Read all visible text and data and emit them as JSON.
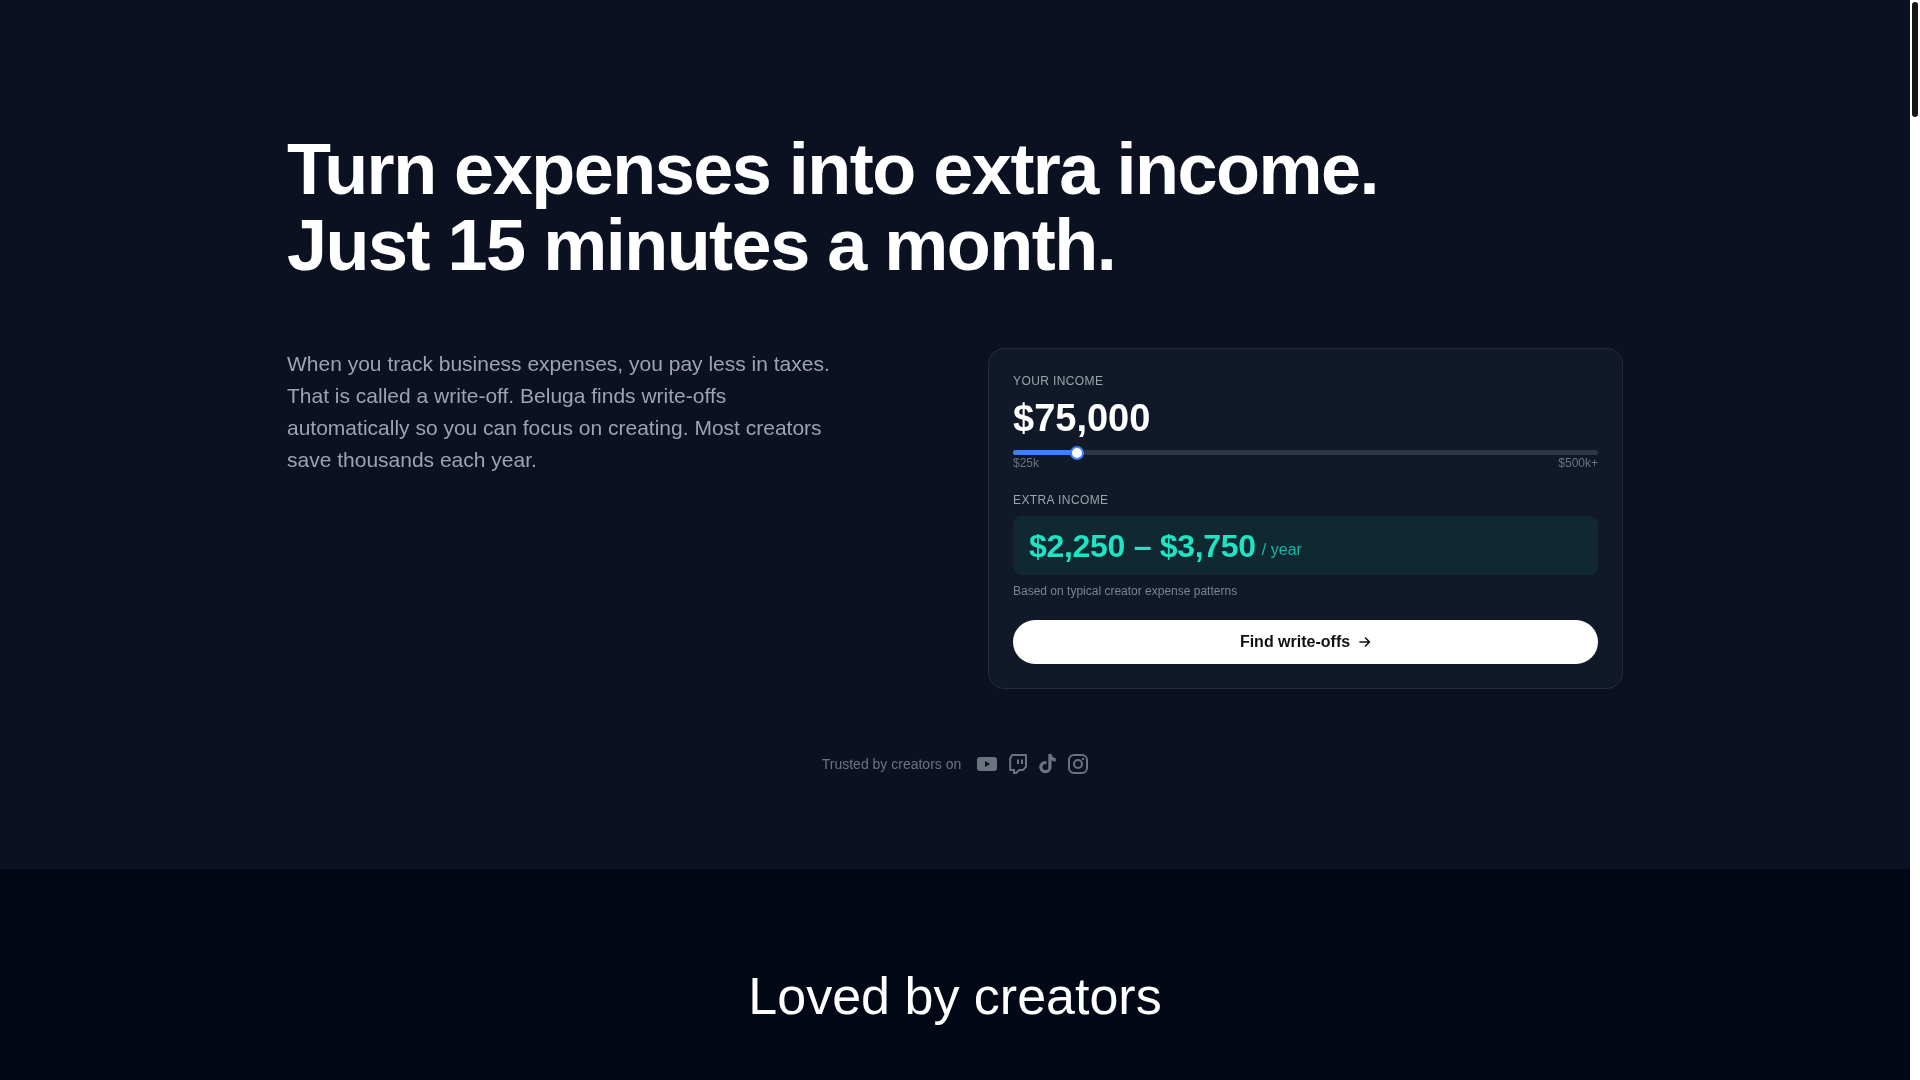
{
  "hero": {
    "headline_lines": [
      "Turn expenses into extra income.",
      "Just 15 minutes a month."
    ],
    "description": "When you track business expenses, you pay less in taxes. That is called a write-off. Beluga finds write-offs automatically so you can focus on creating. Most creators save thousands each year."
  },
  "calculator": {
    "income_label": "YOUR INCOME",
    "income_value": "$75,000",
    "slider": {
      "level": 0.11,
      "min_label": "$25k",
      "max_label": "$500k+"
    },
    "extra_label": "EXTRA INCOME",
    "extra_range": "$2,250 – $3,750",
    "extra_unit": "/ year",
    "note": "Based on typical creator expense patterns",
    "button": {
      "label": "Find write-offs"
    }
  },
  "trusted": {
    "text": "Trusted by creators on"
  },
  "testimonials": {
    "title": "Loved by creators"
  }
}
